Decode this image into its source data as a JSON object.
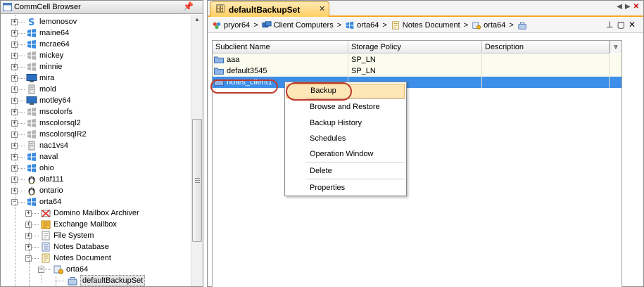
{
  "left_pane": {
    "title": "CommCell Browser",
    "pin_icon": "pin-icon",
    "tree": [
      {
        "label": "lemonosov",
        "icon": "server-s-icon",
        "depth": 1
      },
      {
        "label": "maine64",
        "icon": "windows-icon",
        "depth": 1
      },
      {
        "label": "mcrae64",
        "icon": "windows-icon",
        "depth": 1
      },
      {
        "label": "mickey",
        "icon": "windows-gray-icon",
        "depth": 1
      },
      {
        "label": "minnie",
        "icon": "windows-gray-icon",
        "depth": 1
      },
      {
        "label": "mira",
        "icon": "monitor-icon",
        "depth": 1
      },
      {
        "label": "mold",
        "icon": "server-box-icon",
        "depth": 1
      },
      {
        "label": "motley64",
        "icon": "monitor-icon",
        "depth": 1
      },
      {
        "label": "mscolorfs",
        "icon": "windows-gray-icon",
        "depth": 1
      },
      {
        "label": "mscolorsql2",
        "icon": "windows-gray-icon",
        "depth": 1
      },
      {
        "label": "mscolorsqlR2",
        "icon": "windows-gray-icon",
        "depth": 1
      },
      {
        "label": "nac1vs4",
        "icon": "server-box-icon",
        "depth": 1
      },
      {
        "label": "naval",
        "icon": "windows-icon",
        "depth": 1
      },
      {
        "label": "ohio",
        "icon": "windows-icon",
        "depth": 1
      },
      {
        "label": "olaf111",
        "icon": "linux-icon",
        "depth": 1
      },
      {
        "label": "ontario",
        "icon": "linux-icon",
        "depth": 1
      },
      {
        "label": "orta64",
        "icon": "windows-icon",
        "depth": 1
      },
      {
        "label": "Domino Mailbox Archiver",
        "icon": "mailbox-archiver-icon",
        "depth": 2
      },
      {
        "label": "Exchange Mailbox",
        "icon": "exchange-icon",
        "depth": 2
      },
      {
        "label": "File System",
        "icon": "file-system-icon",
        "depth": 2
      },
      {
        "label": "Notes Database",
        "icon": "notes-database-icon",
        "depth": 2
      },
      {
        "label": "Notes Document",
        "icon": "notes-document-icon",
        "depth": 2
      },
      {
        "label": "orta64",
        "icon": "instance-icon",
        "depth": 3
      },
      {
        "label": "defaultBackupSet",
        "icon": "backupset-icon",
        "depth": 4
      }
    ]
  },
  "right_pane": {
    "tab": {
      "label": "defaultBackupSet",
      "close": "✕"
    },
    "tab_nav": {
      "prev": "◀",
      "next": "▶",
      "close": "✕"
    },
    "breadcrumb": [
      {
        "label": "pryor64",
        "icon": "commcell-icon"
      },
      {
        "label": "Client Computers",
        "icon": "client-computers-icon"
      },
      {
        "label": "orta64",
        "icon": "windows-icon"
      },
      {
        "label": "Notes Document",
        "icon": "notes-document-icon"
      },
      {
        "label": "orta64",
        "icon": "instance-icon"
      },
      {
        "label": "",
        "icon": "backupset-icon"
      }
    ],
    "breadcrumb_separator": ">",
    "view_tools": [
      "pin-icon",
      "restore-icon",
      "close-icon"
    ],
    "grid": {
      "columns": [
        "Subclient Name",
        "Storage Policy",
        "Description"
      ],
      "rows": [
        {
          "name": "aaa",
          "storage_policy": "SP_LN",
          "description": ""
        },
        {
          "name": "default3545",
          "storage_policy": "SP_LN",
          "description": ""
        },
        {
          "name": "notes_client1",
          "storage_policy": "",
          "description": ""
        }
      ],
      "selected_row": 2
    },
    "context_menu": {
      "items": [
        {
          "label": "Backup",
          "highlighted": true
        },
        {
          "label": "Browse and Restore"
        },
        {
          "label": "Backup History"
        },
        {
          "label": "Schedules"
        },
        {
          "label": "Operation Window"
        },
        {
          "label": "Delete"
        },
        {
          "label": "Properties"
        }
      ]
    }
  },
  "colors": {
    "selection": "#3d8ee8",
    "tab_accent": "#f5a623",
    "callout": "#c0392b",
    "menu_highlight": "#fde6b7"
  }
}
